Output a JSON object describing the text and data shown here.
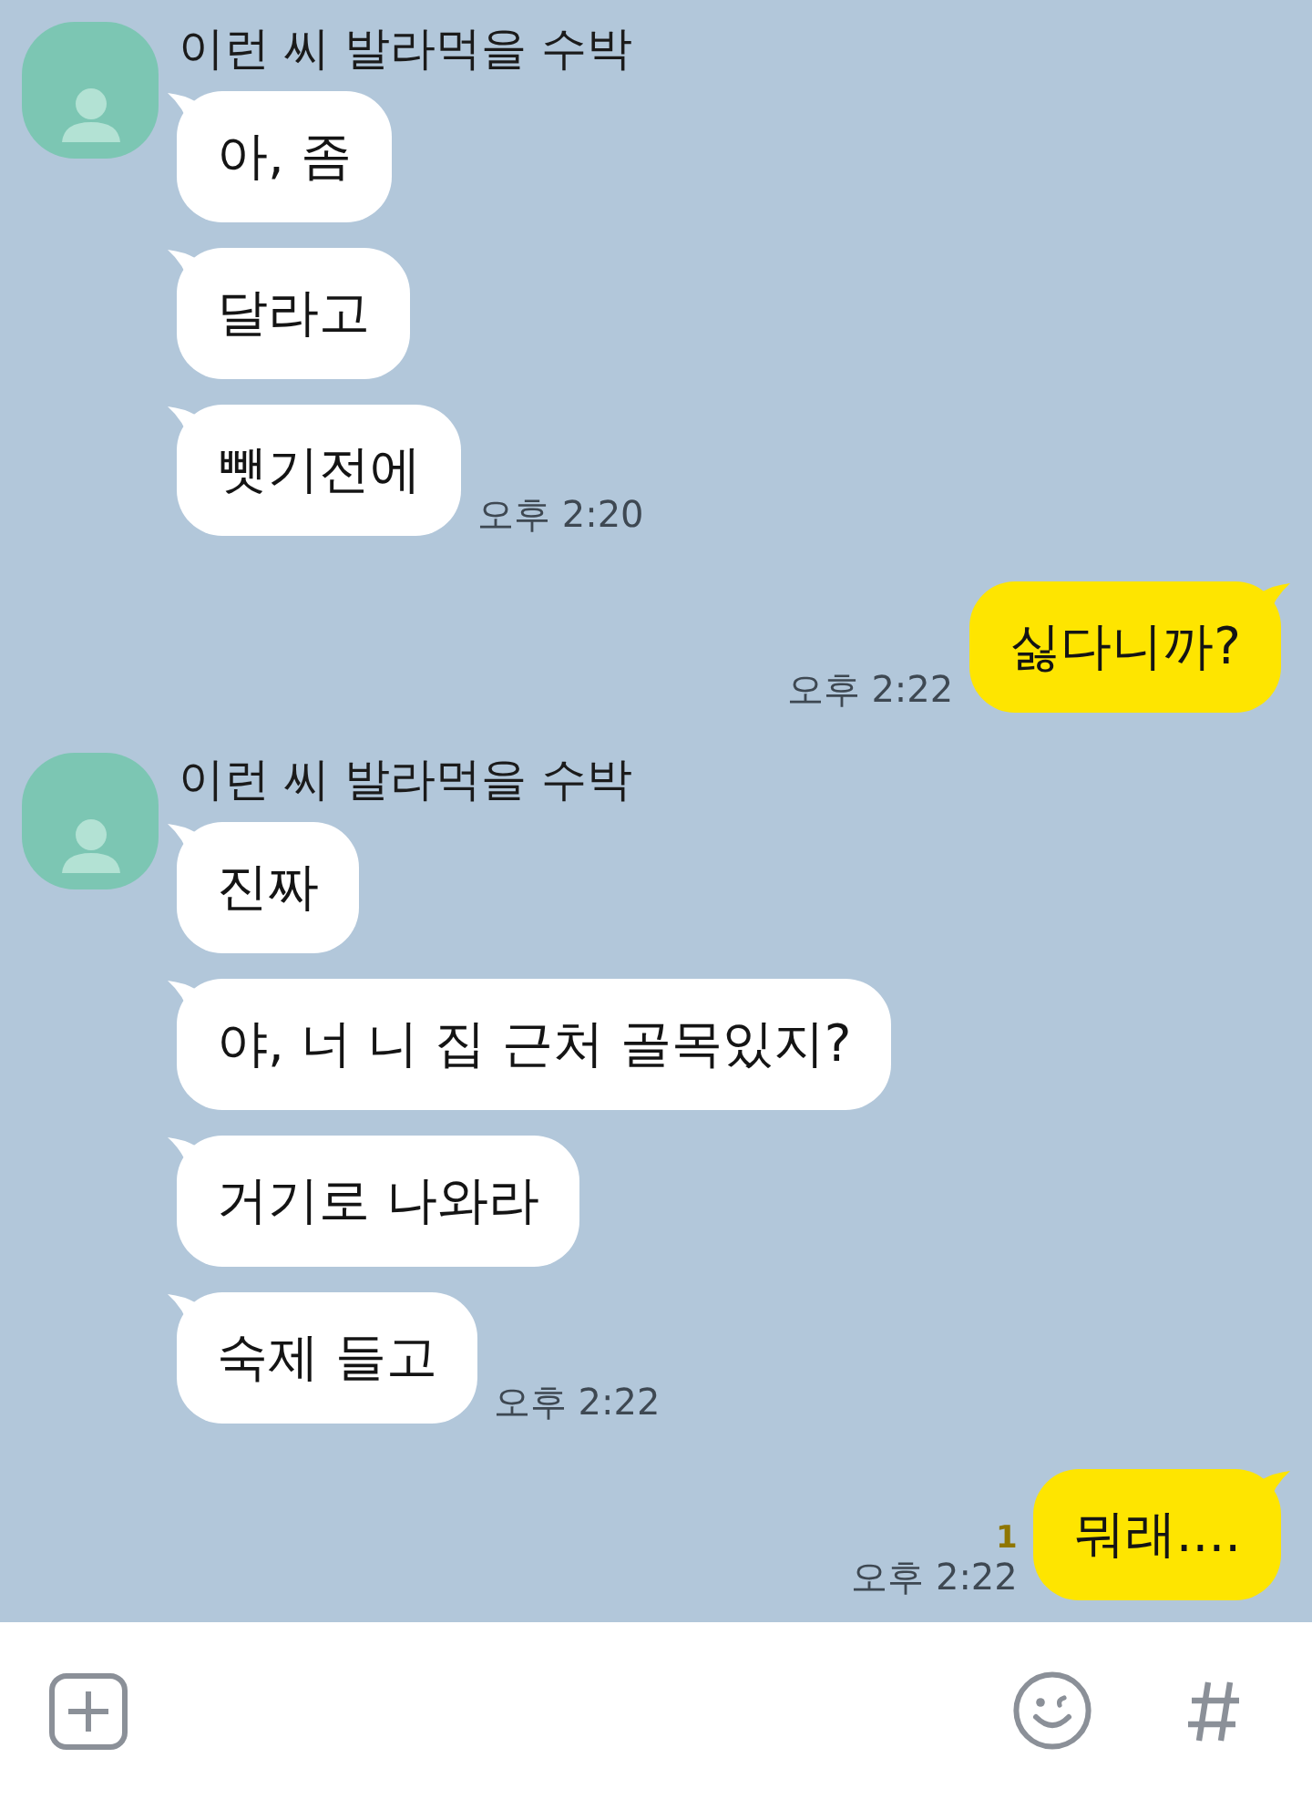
{
  "messages": [
    {
      "kind": "received",
      "sender": "이런 씨 발라먹을 수박",
      "bubbles": [
        "아, 좀",
        "달라고",
        "뺏기전에"
      ],
      "time": "오후 2:20"
    },
    {
      "kind": "sent",
      "bubbles": [
        "싫다니까?"
      ],
      "time": "오후 2:22"
    },
    {
      "kind": "received",
      "sender": "이런 씨 발라먹을 수박",
      "bubbles": [
        "진짜",
        "야, 너 니 집 근처 골목있지?",
        "거기로 나와라",
        "숙제 들고"
      ],
      "time": "오후 2:22"
    },
    {
      "kind": "sent",
      "bubbles": [
        "뭐래...."
      ],
      "unread": "1",
      "time": "오후 2:22"
    }
  ]
}
